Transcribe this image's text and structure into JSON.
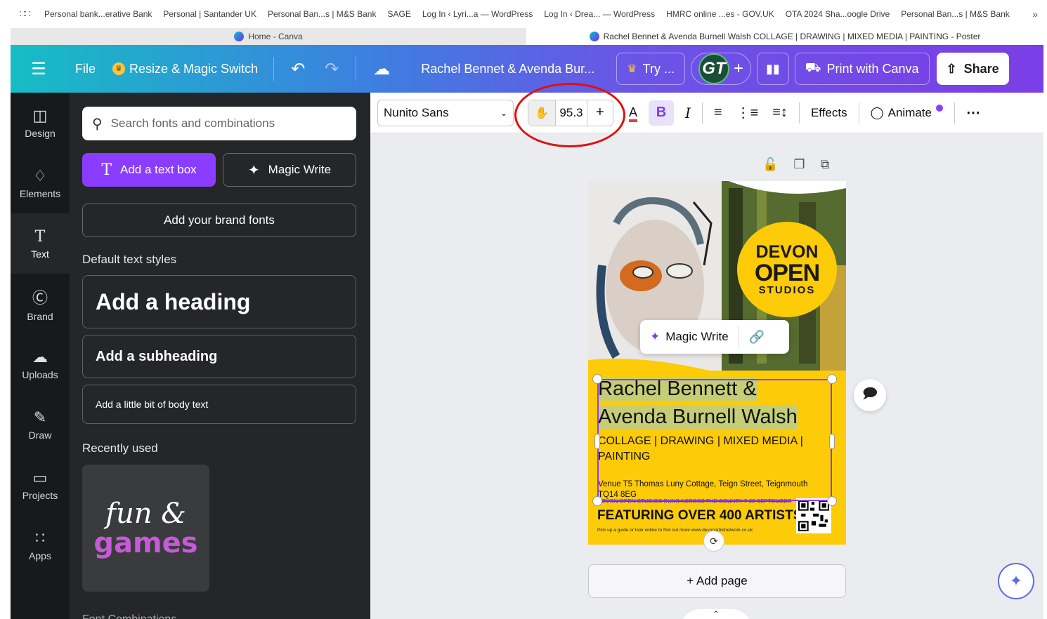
{
  "bookmarks": [
    "Personal bank...erative Bank",
    "Personal | Santander UK",
    "Personal Ban...s | M&S Bank",
    "SAGE",
    "Log In ‹ Lyri...a — WordPress",
    "Log In ‹ Drea... — WordPress",
    "HMRC online ...es - GOV.UK",
    "OTA 2024 Sha...oogle Drive",
    "Personal Ban...s | M&S Bank"
  ],
  "tabs": {
    "inactive": "Home - Canva",
    "active": "Rachel Bennet & Avenda Burnell Walsh COLLAGE | DRAWING | MIXED MEDIA | PAINTING - Poster"
  },
  "topbar": {
    "file": "File",
    "resize": "Resize & Magic Switch",
    "doc_title": "Rachel Bennet & Avenda Bur...",
    "try": "Try ...",
    "avatar": "GT",
    "print": "Print with Canva",
    "share": "Share"
  },
  "sidebar": {
    "items": [
      {
        "label": "Design",
        "icon": "◫"
      },
      {
        "label": "Elements",
        "icon": "♢"
      },
      {
        "label": "Text",
        "icon": "T"
      },
      {
        "label": "Brand",
        "icon": "Ⓒ"
      },
      {
        "label": "Uploads",
        "icon": "☁"
      },
      {
        "label": "Draw",
        "icon": "✎"
      },
      {
        "label": "Projects",
        "icon": "▭"
      },
      {
        "label": "Apps",
        "icon": "∷"
      }
    ]
  },
  "panel": {
    "search_placeholder": "Search fonts and combinations",
    "add_text_box": "Add a text box",
    "magic_write": "Magic Write",
    "brand_fonts": "Add your brand fonts",
    "default_styles": "Default text styles",
    "heading": "Add a heading",
    "subheading": "Add a subheading",
    "body": "Add a little bit of body text",
    "recently_used": "Recently used",
    "recent_line1": "fun &",
    "recent_line2": "games",
    "tail": "Font Combinations"
  },
  "toolbar": {
    "font": "Nunito Sans",
    "size": "95.3",
    "plus": "+",
    "bold": "B",
    "italic": "I",
    "effects": "Effects",
    "animate": "Animate"
  },
  "poster": {
    "logo_line1": "DEVON",
    "logo_line2": "OPEN",
    "logo_line3": "STUDIOS",
    "name_line1": "Rachel Bennett &",
    "name_line2": "Avenda Burnell Walsh",
    "sub_line1": "COLLAGE | DRAWING | MIXED MEDIA |",
    "sub_line2": "PAINTING",
    "venue_line1": "Venue T5 Thomas Luny Cottage, Teign Street, Teignmouth",
    "venue_line2": "TQ14 8EG",
    "strike": "DEVON OPEN STUDIOS RUNS ACROSS THE COUNTY 7-22 SEPTEMBER",
    "featuring": "FEATURING OVER 400 ARTISTS",
    "fineprint": "Pick up a guide or look online to find out more www.devonartistnetwork.co.uk"
  },
  "magic_popup": {
    "label": "Magic Write"
  },
  "add_page": "+ Add page",
  "colors": {
    "accent": "#8b3dff",
    "poster_yellow": "#fecb08",
    "highlight_ring": "#e01010"
  }
}
